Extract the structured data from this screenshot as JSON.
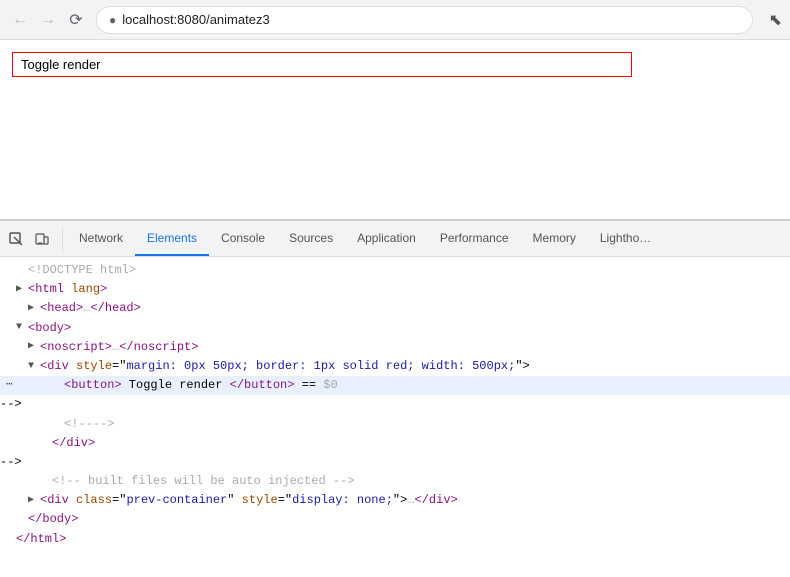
{
  "browser": {
    "url": "localhost:8080/animatez3",
    "back_disabled": true,
    "forward_disabled": true
  },
  "page": {
    "button_label": "Toggle render"
  },
  "devtools": {
    "tabs": [
      {
        "id": "elements",
        "label": "Elements",
        "active": true
      },
      {
        "id": "console",
        "label": "Console",
        "active": false
      },
      {
        "id": "sources",
        "label": "Sources",
        "active": false
      },
      {
        "id": "application",
        "label": "Application",
        "active": false
      },
      {
        "id": "performance",
        "label": "Performance",
        "active": false
      },
      {
        "id": "memory",
        "label": "Memory",
        "active": false
      },
      {
        "id": "lighthouse",
        "label": "Lightho…",
        "active": false
      }
    ],
    "code_lines": [
      {
        "id": "doctype",
        "text": "<!DOCTYPE html>",
        "indent": 0,
        "triangle": "none"
      },
      {
        "id": "html",
        "text": "<html lang>",
        "indent": 0,
        "triangle": "right"
      },
      {
        "id": "head",
        "text": "▶ <head>…</head>",
        "indent": 1,
        "triangle": "none"
      },
      {
        "id": "body-open",
        "text": "▼ <body>",
        "indent": 1,
        "triangle": "none"
      },
      {
        "id": "noscript",
        "text": "▶ <noscript>…</noscript>",
        "indent": 2,
        "triangle": "none"
      },
      {
        "id": "div-open",
        "text": "▼ <div style=\"margin: 0px 50px; border: 1px solid red; width: 500px;\">",
        "indent": 2,
        "triangle": "none"
      },
      {
        "id": "button",
        "text": "<button> Toggle render </button> == $0",
        "indent": 3,
        "triangle": "none",
        "highlighted": true
      },
      {
        "id": "comment1",
        "text": "<!---->",
        "indent": 3,
        "triangle": "none"
      },
      {
        "id": "div-close",
        "text": "</div>",
        "indent": 2,
        "triangle": "none"
      },
      {
        "id": "comment2",
        "text": "<!-- built files will be auto injected -->",
        "indent": 2,
        "triangle": "none"
      },
      {
        "id": "div2",
        "text": "▶ <div class=\"prev-container\" style=\"display: none;\">…</div>",
        "indent": 2,
        "triangle": "none"
      },
      {
        "id": "body-close",
        "text": "</body>",
        "indent": 1,
        "triangle": "none"
      },
      {
        "id": "html-close",
        "text": "</html>",
        "indent": 0,
        "triangle": "none"
      }
    ]
  }
}
